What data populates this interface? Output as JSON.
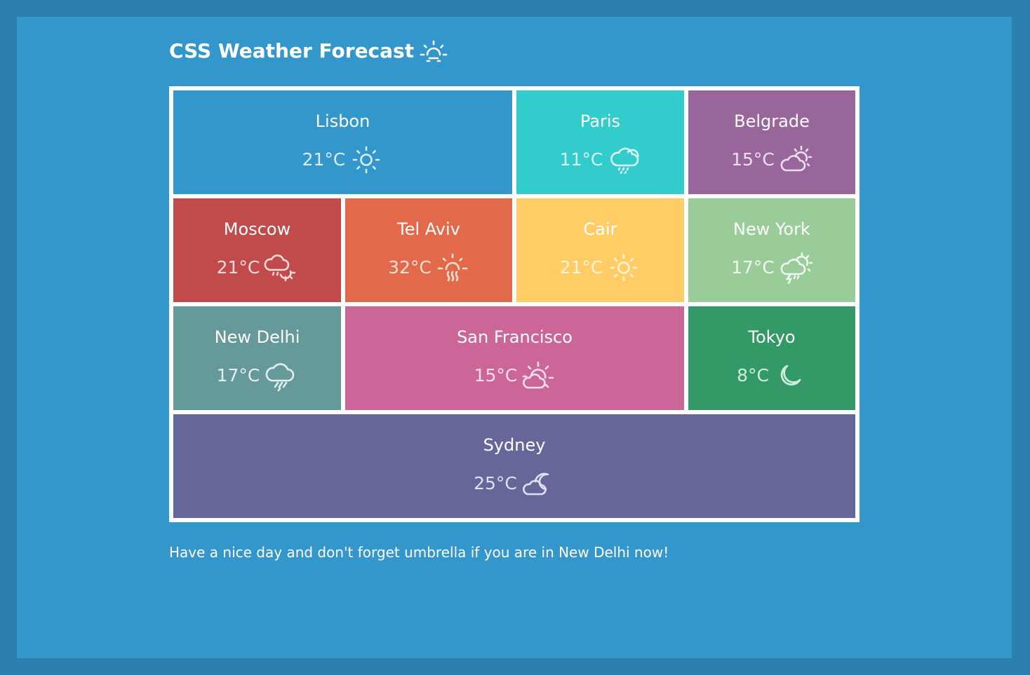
{
  "page": {
    "title": "CSS Weather Forecast",
    "title_icon": "sunrise-icon",
    "footer": "Have a nice day and don't forget umbrella if you are in New Delhi now!"
  },
  "colors": {
    "outer_background": "#2b7fae",
    "page_background": "#3497cb",
    "grid_border": "#ffffff"
  },
  "cities": [
    {
      "name": "Lisbon",
      "temp": "21°C",
      "icon": "sun-icon",
      "bg": "#3497cb",
      "fg": "#d9ecf7"
    },
    {
      "name": "Paris",
      "temp": "11°C",
      "icon": "cloud-drizzle-icon",
      "bg": "#33cccc",
      "fg": "#d9f5f5"
    },
    {
      "name": "Belgrade",
      "temp": "15°C",
      "icon": "partly-cloudy-day-icon",
      "bg": "#99669b",
      "fg": "#ecdfef"
    },
    {
      "name": "Moscow",
      "temp": "21°C",
      "icon": "cloud-sun-rain-icon",
      "bg": "#c14b4b",
      "fg": "#f4dada"
    },
    {
      "name": "Tel Aviv",
      "temp": "32°C",
      "icon": "sun-haze-icon",
      "bg": "#e26a4b",
      "fg": "#fbe0d6"
    },
    {
      "name": "Cair",
      "temp": "21°C",
      "icon": "sun-icon",
      "bg": "#ffcc66",
      "fg": "#fff3d6"
    },
    {
      "name": "New York",
      "temp": "17°C",
      "icon": "thunderstorm-sun-icon",
      "bg": "#99cc99",
      "fg": "#eef8ee"
    },
    {
      "name": "New Delhi",
      "temp": "17°C",
      "icon": "cloud-rain-icon",
      "bg": "#669999",
      "fg": "#e2efef"
    },
    {
      "name": "San Francisco",
      "temp": "15°C",
      "icon": "partly-cloudy-day-icon",
      "bg": "#cc6699",
      "fg": "#f7e0ec"
    },
    {
      "name": "Tokyo",
      "temp": "8°C",
      "icon": "moon-icon",
      "bg": "#339966",
      "fg": "#cdeedd"
    },
    {
      "name": "Sydney",
      "temp": "25°C",
      "icon": "partly-cloudy-night-icon",
      "bg": "#666699",
      "fg": "#e0e0f0"
    }
  ]
}
